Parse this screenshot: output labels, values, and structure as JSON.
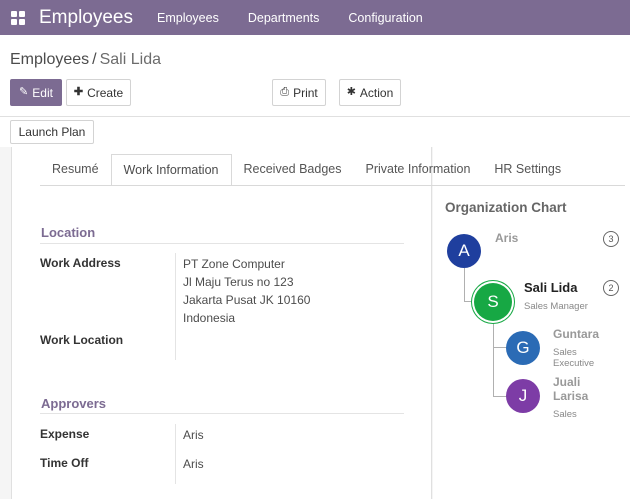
{
  "navbar": {
    "app_title": "Employees",
    "menu": [
      "Employees",
      "Departments",
      "Configuration"
    ],
    "color": "#7c6b92"
  },
  "breadcrumb": {
    "parent": "Employees",
    "separator": "/",
    "current": "Sali Lida"
  },
  "toolbar": {
    "edit_label": "Edit",
    "create_label": "Create",
    "print_label": "Print",
    "action_label": "Action",
    "launch_plan_label": "Launch Plan"
  },
  "tabs": [
    {
      "label": "Resumé",
      "active": false
    },
    {
      "label": "Work Information",
      "active": true
    },
    {
      "label": "Received Badges",
      "active": false
    },
    {
      "label": "Private Information",
      "active": false
    },
    {
      "label": "HR Settings",
      "active": false
    }
  ],
  "location": {
    "title": "Location",
    "work_address_label": "Work Address",
    "work_address_lines": [
      "PT Zone Computer",
      "Jl Maju Terus no 123",
      "Jakarta Pusat JK 10160",
      "Indonesia"
    ],
    "work_location_label": "Work Location"
  },
  "approvers": {
    "title": "Approvers",
    "expense_label": "Expense",
    "expense_value": "Aris",
    "time_off_label": "Time Off",
    "time_off_value": "Aris"
  },
  "org_chart": {
    "title": "Organization Chart",
    "manager": {
      "initial": "A",
      "name": "Aris",
      "count": "3",
      "color": "#1f3f9e"
    },
    "self": {
      "initial": "S",
      "name": "Sali Lida",
      "job": "Sales Manager",
      "count": "2",
      "color": "#17a844"
    },
    "subordinates": [
      {
        "initial": "G",
        "name": "Guntara",
        "job_lines": [
          "Sales",
          "Executive"
        ],
        "color": "#2b6bb5"
      },
      {
        "initial": "J",
        "name_lines": [
          "Juali",
          "Larisa"
        ],
        "job_lines": [
          "Sales"
        ],
        "color": "#7d3ca6"
      }
    ]
  }
}
